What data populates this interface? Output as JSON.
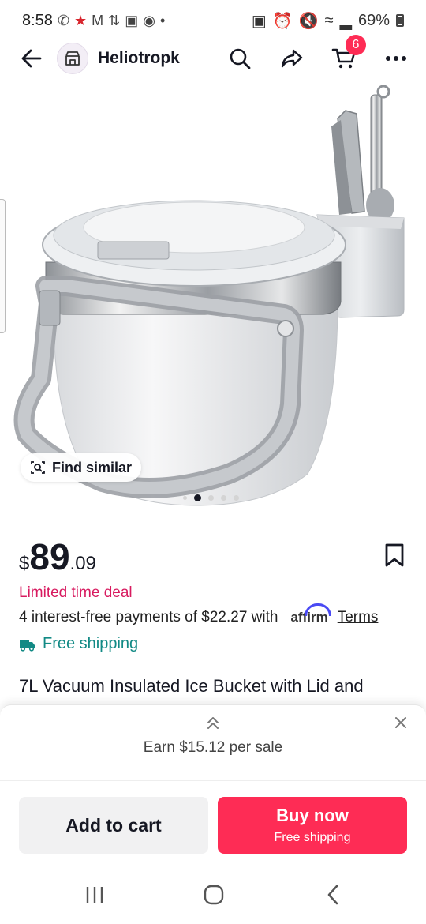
{
  "status_bar": {
    "time": "8:58",
    "battery": "69%"
  },
  "header": {
    "shop_name": "Heliotropk",
    "cart_count": "6"
  },
  "gallery": {
    "find_similar_label": "Find similar",
    "image_count": 5,
    "active_index": 1
  },
  "price": {
    "currency": "$",
    "whole": "89",
    "cents": ".09"
  },
  "deal_label": "Limited time deal",
  "installments": {
    "text": "4 interest-free payments of $22.27 with",
    "provider": "affirm",
    "terms_label": "Terms"
  },
  "shipping_label": "Free shipping",
  "product_title": "7L Vacuum Insulated Ice Bucket with Lid and",
  "earn_sheet": {
    "text": "Earn $15.12 per sale"
  },
  "actions": {
    "add_to_cart": "Add to cart",
    "buy_now": "Buy now",
    "buy_now_sub": "Free shipping"
  },
  "colors": {
    "accent": "#fe2c55",
    "deal": "#d81b60",
    "shipping": "#128a85",
    "affirm": "#4a4af4"
  }
}
